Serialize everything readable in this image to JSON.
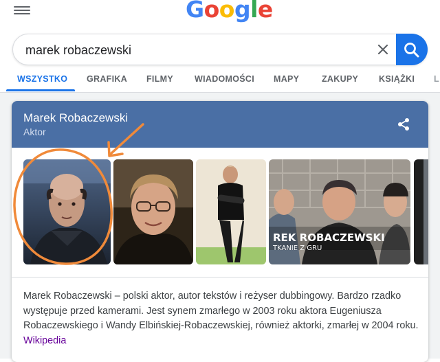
{
  "header": {
    "logo_letters": [
      {
        "char": "G",
        "color": "#4285F4"
      },
      {
        "char": "o",
        "color": "#EA4335"
      },
      {
        "char": "o",
        "color": "#FBBC05"
      },
      {
        "char": "g",
        "color": "#4285F4"
      },
      {
        "char": "l",
        "color": "#34A853"
      },
      {
        "char": "e",
        "color": "#EA4335"
      }
    ],
    "menu_icon": "hamburger-menu-icon"
  },
  "search": {
    "query": "marek robaczewski",
    "clear_icon": "close-icon",
    "submit_icon": "search-icon",
    "accent_color": "#1a73e8"
  },
  "tabs": [
    {
      "label": "WSZYSTKO",
      "active": true
    },
    {
      "label": "GRAFIKA",
      "active": false
    },
    {
      "label": "FILMY",
      "active": false
    },
    {
      "label": "WIADOMOŚCI",
      "active": false
    },
    {
      "label": "MAPY",
      "active": false
    },
    {
      "label": "ZAKUPY",
      "active": false
    },
    {
      "label": "KSIĄŻKI",
      "active": false
    }
  ],
  "card": {
    "title": "Marek Robaczewski",
    "subtitle": "Aktor",
    "header_color": "#4a6fa5",
    "share_icon": "share-icon",
    "image_overlay_text": {
      "line1": "REK ROBACZEWSKI",
      "line2": "TKANIE Z GRU"
    },
    "description": "Marek Robaczewski – polski aktor, autor tekstów i reżyser dubbingowy. Bardzo rzadko występuje przed kamerami. Jest synem zmarłego w 2003 roku aktora Eugeniusza Robaczewskiego i Wandy Elbińskiej-Robaczewskiej, również aktorki, zmarłej w 2004 roku.",
    "source_link": "Wikipedia"
  },
  "annotation_color": "#f08a3a"
}
